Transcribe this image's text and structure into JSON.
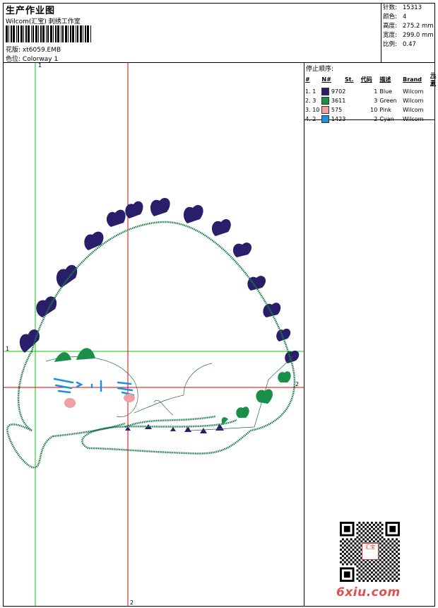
{
  "header": {
    "title": "生产作业图",
    "company": "Wilcom(汇宝) 刺绣工作室",
    "design_label": "花版:",
    "design_value": "xt6059.EMB",
    "colorway_label": "色位:",
    "colorway_value": "Colorway 1"
  },
  "stats": [
    {
      "label": "针数:",
      "value": "15313"
    },
    {
      "label": "颜色:",
      "value": "4"
    },
    {
      "label": "高度:",
      "value": "275.2 mm"
    },
    {
      "label": "宽度:",
      "value": "299.0 mm"
    },
    {
      "label": "比例:",
      "value": "0.47"
    }
  ],
  "legend": {
    "title": "停止顺序:",
    "columns": [
      "#",
      "N#",
      "St.",
      "代码",
      "描述",
      "Brand",
      "元素"
    ],
    "rows": [
      {
        "idx": "1.",
        "n": "1",
        "color": "#2a1e6b",
        "st": "9702",
        "code": "1",
        "desc": "Blue",
        "brand": "Wilcom"
      },
      {
        "idx": "2.",
        "n": "3",
        "color": "#1a8f4a",
        "st": "3611",
        "code": "3",
        "desc": "Green",
        "brand": "Wilcom"
      },
      {
        "idx": "3.",
        "n": "10",
        "color": "#f0a0a0",
        "st": "575",
        "code": "10",
        "desc": "Pink",
        "brand": "Wilcom"
      },
      {
        "idx": "4.",
        "n": "2",
        "color": "#1e90e0",
        "st": "1423",
        "code": "2",
        "desc": "Cyan",
        "brand": "Wilcom"
      }
    ]
  },
  "axes": {
    "v1": "1",
    "h1": "1",
    "h2": "2",
    "v2": "2"
  },
  "watermark": "6xiu.com",
  "seal_text": "汇宝"
}
